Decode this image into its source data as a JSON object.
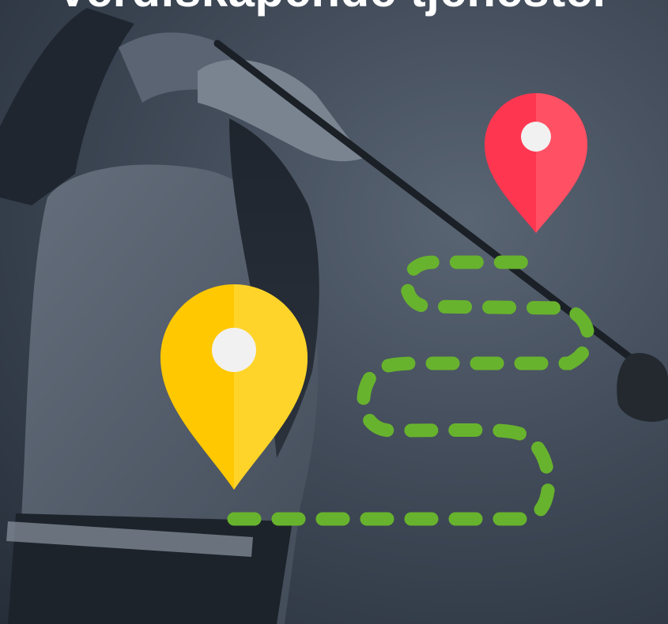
{
  "headline": {
    "text": "Verdiskapende tjenester"
  },
  "pins": [
    {
      "name": "start-pin",
      "color": "#ffc800",
      "color_light": "#ffd42a",
      "icon": "map-pin-icon"
    },
    {
      "name": "destination-pin",
      "color": "#ff3650",
      "color_light": "#ff5064",
      "icon": "map-pin-icon"
    }
  ],
  "route": {
    "color": "#68b32d",
    "style": "dashed",
    "icon": "dashed-route-line"
  },
  "background": {
    "subject": "golfer-photo",
    "tint": "#36404e"
  }
}
